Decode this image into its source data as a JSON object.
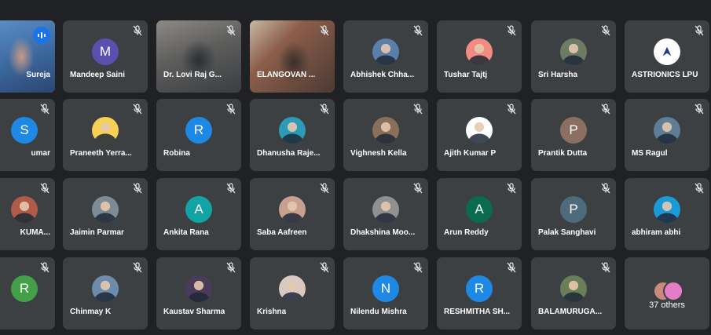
{
  "meeting": {
    "colors": {
      "background": "#202124",
      "tile": "#3c4043",
      "active_border": "#8ab4f8",
      "speaking": "#1a73e8"
    },
    "tiles": [
      {
        "name": "Sureja",
        "type": "photo",
        "active": true,
        "speaking": true,
        "muted": false,
        "avatar_color": "#c98a7a"
      },
      {
        "name": "Mandeep Saini",
        "type": "letter",
        "initial": "M",
        "avatar_color": "#5b4fb0",
        "muted": true
      },
      {
        "name": "Dr. Lovi Raj G...",
        "type": "video",
        "video_style": "cool",
        "muted": true
      },
      {
        "name": "ELANGOVAN ...",
        "type": "video",
        "video_style": "warm",
        "muted": true
      },
      {
        "name": "Abhishek Chha...",
        "type": "photo",
        "avatar_color": "#5a7fa8",
        "muted": true
      },
      {
        "name": "Tushar Tajtj",
        "type": "photo",
        "avatar_color": "#f28b82",
        "muted": true
      },
      {
        "name": "Sri Harsha",
        "type": "photo",
        "avatar_color": "#6e7b63",
        "muted": true
      },
      {
        "name": "ASTRIONICS LPU",
        "type": "logo",
        "avatar_color": "#ffffff",
        "muted": true
      },
      {
        "name": "umar",
        "type": "letter",
        "initial": "S",
        "avatar_color": "#1e88e5",
        "muted": true
      },
      {
        "name": "Praneeth Yerra...",
        "type": "photo",
        "avatar_color": "#f6d154",
        "muted": true
      },
      {
        "name": "Robina",
        "type": "letter",
        "initial": "R",
        "avatar_color": "#1e88e5",
        "muted": true
      },
      {
        "name": "Dhanusha Raje...",
        "type": "photo",
        "avatar_color": "#2d9ab7",
        "muted": true
      },
      {
        "name": "Vighnesh Kella",
        "type": "photo",
        "avatar_color": "#8a6f5a",
        "muted": true
      },
      {
        "name": "Ajith Kumar P",
        "type": "photo",
        "avatar_color": "#ffffff",
        "muted": true
      },
      {
        "name": "Prantik Dutta",
        "type": "letter",
        "initial": "P",
        "avatar_color": "#8d6e63",
        "muted": true
      },
      {
        "name": "MS Ragul",
        "type": "photo",
        "avatar_color": "#5f7d95",
        "muted": true
      },
      {
        "name": "KUMA...",
        "type": "photo",
        "avatar_color": "#b05a4a",
        "muted": true
      },
      {
        "name": "Jaimin Parmar",
        "type": "photo",
        "avatar_color": "#7d8b97",
        "muted": true
      },
      {
        "name": "Ankita Rana",
        "type": "letter",
        "initial": "A",
        "avatar_color": "#12a4a4",
        "muted": true
      },
      {
        "name": "Saba Aafreen",
        "type": "photo",
        "avatar_color": "#c8a090",
        "muted": true
      },
      {
        "name": "Dhakshina Moo...",
        "type": "photo",
        "avatar_color": "#909090",
        "muted": true
      },
      {
        "name": "Arun Reddy",
        "type": "letter",
        "initial": "A",
        "avatar_color": "#0b6b4f",
        "muted": true
      },
      {
        "name": "Palak Sanghavi",
        "type": "letter",
        "initial": "P",
        "avatar_color": "#4d6b7a",
        "muted": true
      },
      {
        "name": "abhiram abhi",
        "type": "photo",
        "avatar_color": "#1a9bd7",
        "muted": true
      },
      {
        "name": "",
        "type": "letter",
        "initial": "R",
        "avatar_color": "#43a047",
        "muted": true
      },
      {
        "name": "Chinmay K",
        "type": "photo",
        "avatar_color": "#6d8cab",
        "muted": true
      },
      {
        "name": "Kaustav Sharma",
        "type": "photo",
        "avatar_color": "#4a3b5a",
        "muted": true
      },
      {
        "name": "Krishna",
        "type": "photo",
        "avatar_color": "#d9c9c0",
        "muted": true
      },
      {
        "name": "Nilendu Mishra",
        "type": "letter",
        "initial": "N",
        "avatar_color": "#1e88e5",
        "muted": true
      },
      {
        "name": "RESHMITHA SH...",
        "type": "letter",
        "initial": "R",
        "avatar_color": "#1e88e5",
        "muted": true
      },
      {
        "name": "BALAMURUGA...",
        "type": "photo",
        "avatar_color": "#6a7e5a",
        "muted": true
      },
      {
        "name": "others",
        "type": "others",
        "label": "37 others",
        "avatar_colors": [
          "#c98a7a",
          "#e57cc8"
        ]
      }
    ]
  }
}
